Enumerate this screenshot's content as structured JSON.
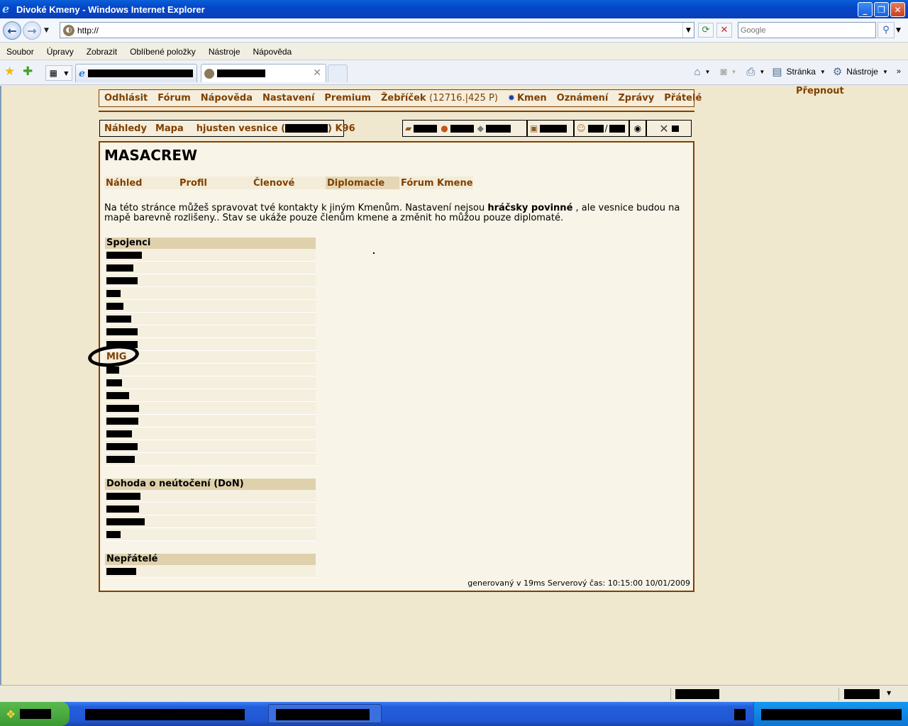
{
  "window": {
    "title": "Divoké Kmeny - Windows Internet Explorer"
  },
  "address": {
    "url": "http://",
    "search_placeholder": "Google"
  },
  "menubar": [
    "Soubor",
    "Úpravy",
    "Zobrazit",
    "Oblíbené položky",
    "Nástroje",
    "Nápověda"
  ],
  "commandbar": {
    "page_label": "Stránka",
    "tools_label": "Nástroje"
  },
  "game": {
    "switch_label": "Přepnout",
    "main_menu": {
      "logout": "Odhlásit",
      "forum": "Fórum",
      "help": "Nápověda",
      "settings": "Nastavení",
      "premium": "Premium",
      "ranking": "Žebříček",
      "ranking_detail": "(12716.|425 P)",
      "tribe": "Kmen",
      "reports": "Oznámení",
      "messages": "Zprávy",
      "friends": "Přátelé"
    },
    "village_bar": {
      "overviews": "Náhledy",
      "map": "Mapa",
      "village_prefix": "hjusten vesnice (",
      "village_suffix": ") K96"
    },
    "tribe_name": "MASACREW",
    "tabs": [
      "Náhled",
      "Profil",
      "Členové",
      "Diplomacie",
      "Fórum Kmene"
    ],
    "selected_tab": "Diplomacie",
    "description": {
      "part1": "Na této stránce můžeš spravovat tvé kontakty k jiným Kmenům. Nastavení nejsou ",
      "bold": "hráčsky povinné",
      "part2": " , ale vesnice budou na mapě barevně rozlišeny.. Stav se ukáže pouze členům kmene a změnit ho můžou pouze diplomaté."
    },
    "allies": {
      "header": "Spojenci",
      "visible_name": "MIG"
    },
    "nap": {
      "header": "Dohoda o neútočení (DoN)"
    },
    "enemies": {
      "header": "Nepřátelé"
    },
    "footer": "generovaný v 19ms Serverový čas: 10:15:00 10/01/2009"
  }
}
